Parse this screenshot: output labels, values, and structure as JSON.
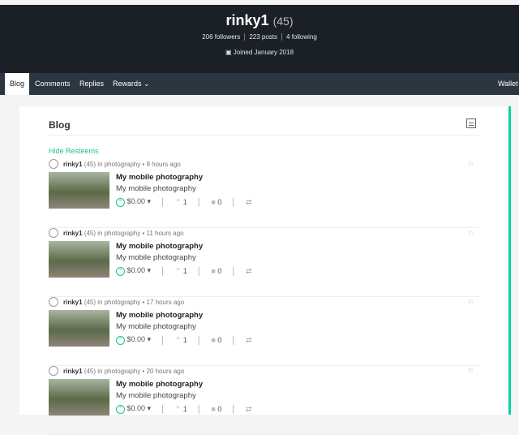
{
  "profile": {
    "name": "rinky1",
    "rep": "(45)",
    "followers": "206 followers",
    "posts": "223 posts",
    "following": "4 following",
    "joined": "Joined January 2018"
  },
  "nav": {
    "blog": "Blog",
    "comments": "Comments",
    "replies": "Replies",
    "rewards": "Rewards ⌄",
    "wallet": "Wallet"
  },
  "main": {
    "title": "Blog",
    "hide_resteems": "Hide Resteems"
  },
  "posts": [
    {
      "author": "rinky1",
      "rep": "(45)",
      "category": "in photography",
      "time": "• 9 hours ago",
      "title": "My mobile photography",
      "desc": "My mobile photography",
      "payout": "$0.00 ▾",
      "votes": "1",
      "comments": "0"
    },
    {
      "author": "rinky1",
      "rep": "(45)",
      "category": "in photography",
      "time": "• 11 hours ago",
      "title": "My mobile photography",
      "desc": "My mobile photography",
      "payout": "$0.00 ▾",
      "votes": "1",
      "comments": "0"
    },
    {
      "author": "rinky1",
      "rep": "(45)",
      "category": "in photography",
      "time": "• 17 hours ago",
      "title": "My mobile photography",
      "desc": "My mobile photography",
      "payout": "$0.00 ▾",
      "votes": "1",
      "comments": "0"
    },
    {
      "author": "rinky1",
      "rep": "(45)",
      "category": "in photography",
      "time": "• 20 hours ago",
      "title": "My mobile photography",
      "desc": "My mobile photography",
      "payout": "$0.00 ▾",
      "votes": "1",
      "comments": "0"
    }
  ]
}
